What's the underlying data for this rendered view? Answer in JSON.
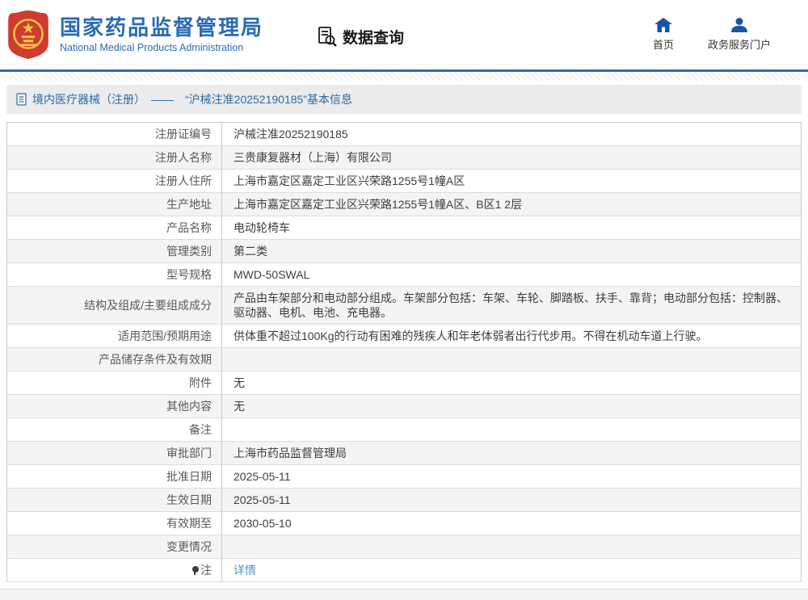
{
  "colors": {
    "accent_blue": "#2a6bb4",
    "divider_blue": "#2e6da4",
    "link_blue": "#4d94c8",
    "breadcrumb_bg": "#ececec",
    "zebra_row": "#f4f4f4",
    "emblem_red": "#d03a31",
    "emblem_gold": "#f2c347"
  },
  "header": {
    "org_name_cn": "国家药品监督管理局",
    "org_name_en": "National Medical Products Administration",
    "section_title": "数据查询",
    "nav": [
      {
        "label": "首页",
        "icon": "home-icon"
      },
      {
        "label": "政务服务门户",
        "icon": "user-icon"
      }
    ]
  },
  "breadcrumb": {
    "text": "境内医疗器械（注册）　——　“沪械注准20252190185”基本信息"
  },
  "table": {
    "rows": [
      {
        "label": "注册证编号",
        "value": "沪械注准20252190185"
      },
      {
        "label": "注册人名称",
        "value": "三贵康复器材（上海）有限公司"
      },
      {
        "label": "注册人住所",
        "value": "上海市嘉定区嘉定工业区兴荣路1255号1幢A区"
      },
      {
        "label": "生产地址",
        "value": "上海市嘉定区嘉定工业区兴荣路1255号1幢A区、B区1 2层"
      },
      {
        "label": "产品名称",
        "value": "电动轮椅车"
      },
      {
        "label": "管理类别",
        "value": "第二类"
      },
      {
        "label": "型号规格",
        "value": "MWD-50SWAL"
      },
      {
        "label": "结构及组成/主要组成成分",
        "value": "产品由车架部分和电动部分组成。车架部分包括：车架、车轮、脚踏板、扶手、靠背；电动部分包括：控制器、驱动器、电机、电池、充电器。"
      },
      {
        "label": "适用范围/预期用途",
        "value": "供体重不超过100Kg的行动有困难的残疾人和年老体弱者出行代步用。不得在机动车道上行驶。"
      },
      {
        "label": "产品储存条件及有效期",
        "value": ""
      },
      {
        "label": "附件",
        "value": "无"
      },
      {
        "label": "其他内容",
        "value": "无"
      },
      {
        "label": "备注",
        "value": ""
      },
      {
        "label": "审批部门",
        "value": "上海市药品监督管理局"
      },
      {
        "label": "批准日期",
        "value": "2025-05-11"
      },
      {
        "label": "生效日期",
        "value": "2025-05-11"
      },
      {
        "label": "有效期至",
        "value": "2030-05-10"
      },
      {
        "label": "变更情况",
        "value": ""
      },
      {
        "label": "注",
        "icon": "pin-icon",
        "value": "详情",
        "link": true
      }
    ]
  }
}
